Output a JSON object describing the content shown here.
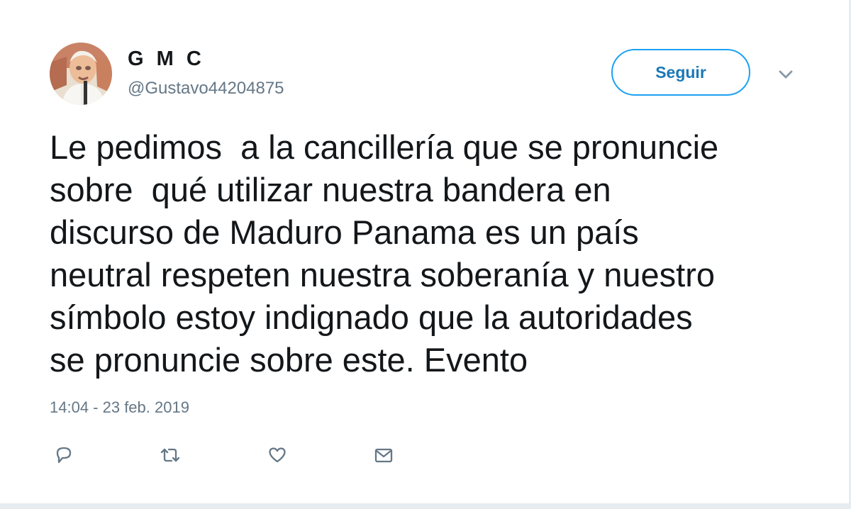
{
  "user": {
    "display_name": "G M C",
    "handle": "@Gustavo44204875",
    "avatar_icon": "profile-photo"
  },
  "follow_button": {
    "label": "Seguir"
  },
  "menu": {
    "icon": "chevron-down-icon"
  },
  "tweet": {
    "text": "Le pedimos  a la cancillería que se pronuncie\nsobre  qué utilizar nuestra bandera en\ndiscurso de Maduro Panama es un país\nneutral respeten nuestra soberanía y nuestro\nsímbolo estoy indignado que la autoridades\nse pronuncie sobre este. Evento",
    "timestamp": "14:04 - 23 feb. 2019"
  },
  "actions": [
    {
      "name": "reply",
      "icon": "reply-icon"
    },
    {
      "name": "retweet",
      "icon": "retweet-icon"
    },
    {
      "name": "like",
      "icon": "heart-icon"
    },
    {
      "name": "message",
      "icon": "envelope-icon"
    }
  ],
  "colors": {
    "text": "#14171a",
    "secondary_text": "#657786",
    "accent": "#1da1f2",
    "button_text": "#1b78b6"
  }
}
